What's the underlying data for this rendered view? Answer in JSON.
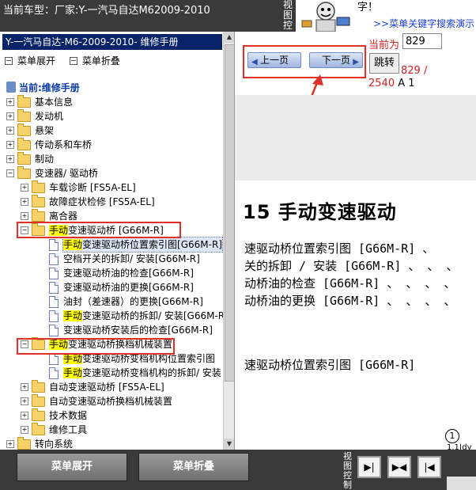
{
  "header": {
    "car_info": "当前车型：厂家:Y-一汽马自达M62009-2010",
    "side_text": "视图控",
    "top_right_line1": "字！",
    "top_right_link": ">>菜单关键字搜索演示"
  },
  "left_panel": {
    "title": "Y-一汽马自达-M6-2009-2010- 维修手册",
    "expand_label": "菜单展开",
    "collapse_label": "菜单折叠",
    "tree": [
      {
        "label": "当前:维修手册",
        "type": "root"
      },
      {
        "label": "基本信息",
        "type": "folder",
        "level": 0
      },
      {
        "label": "发动机",
        "type": "folder",
        "level": 0
      },
      {
        "label": "悬架",
        "type": "folder",
        "level": 0
      },
      {
        "label": "传动系和车桥",
        "type": "folder",
        "level": 0
      },
      {
        "label": "制动",
        "type": "folder",
        "level": 0
      },
      {
        "label": "变速器/ 驱动桥",
        "type": "folder",
        "level": 0,
        "expanded": true
      },
      {
        "label": "车载诊断 [FS5A-EL]",
        "type": "folder",
        "level": 1
      },
      {
        "label": "故障症状检修 [FS5A-EL]",
        "type": "folder",
        "level": 1
      },
      {
        "label": "离合器",
        "type": "folder",
        "level": 1
      },
      {
        "label_hl": "手动",
        "label": "变速驱动桥 [G66M-R]",
        "type": "folder",
        "level": 1,
        "expanded": true
      },
      {
        "label_hl": "手动",
        "label": "变速驱动桥位置索引图[G66M-R]",
        "type": "doc",
        "level": 2,
        "selected": true
      },
      {
        "label": "空档开关的拆卸/ 安装[G66M-R]",
        "type": "doc",
        "level": 2
      },
      {
        "label": "变速驱动桥油的检查[G66M-R]",
        "type": "doc",
        "level": 2
      },
      {
        "label": "变速驱动桥油的更换[G66M-R]",
        "type": "doc",
        "level": 2
      },
      {
        "label": "油封（差速器）的更换[G66M-R]",
        "type": "doc",
        "level": 2
      },
      {
        "label_hl": "手动",
        "label": "变速驱动桥的拆卸/ 安装[G66M-R]",
        "type": "doc",
        "level": 2
      },
      {
        "label": "变速驱动桥安装后的检查[G66M-R]",
        "type": "doc",
        "level": 2
      },
      {
        "label_hl": "手动",
        "label": "变速驱动桥换档机械装置",
        "type": "folder",
        "level": 1,
        "expanded": true
      },
      {
        "label_hl": "手动",
        "label": "变速驱动桥变档机构位置索引图",
        "type": "doc",
        "level": 2
      },
      {
        "label_hl": "手动",
        "label": "变速驱动桥变档机构的拆卸/ 安装",
        "type": "doc",
        "level": 2
      },
      {
        "label": "自动变速驱动桥 [FS5A-EL]",
        "type": "folder",
        "level": 1
      },
      {
        "label": "自动变速驱动桥换档机械装置",
        "type": "folder",
        "level": 1
      },
      {
        "label": "技术数据",
        "type": "folder",
        "level": 1
      },
      {
        "label": "维修工具",
        "type": "folder",
        "level": 1
      },
      {
        "label": "转向系统",
        "type": "folder",
        "level": 0
      }
    ]
  },
  "right_panel": {
    "prev_label": "上一页",
    "next_label": "下一页",
    "current_label": "当前为",
    "page_value": "829",
    "jump_label": "跳转",
    "page_count": "829 /",
    "page_total": "2540",
    "page_suffix": "A 1",
    "doc_title": "15   手动变速驱动",
    "doc_lines": [
      "速驱动桥位置索引图 [G66M-R] 、",
      "关的拆卸 / 安装 [G66M-R] 、 、 、",
      "动桥油的检查 [G66M-R] 、 、 、 、",
      "动桥油的更换 [G66M-R] 、 、 、 、"
    ],
    "doc_sub": "速驱动桥位置索引图 [G66M-R]",
    "circle_num": "①",
    "bottom_text": "1.1|dy"
  },
  "footer": {
    "expand_label": "菜单展开",
    "collapse_label": "菜单折叠",
    "view_label": "视图控制"
  }
}
